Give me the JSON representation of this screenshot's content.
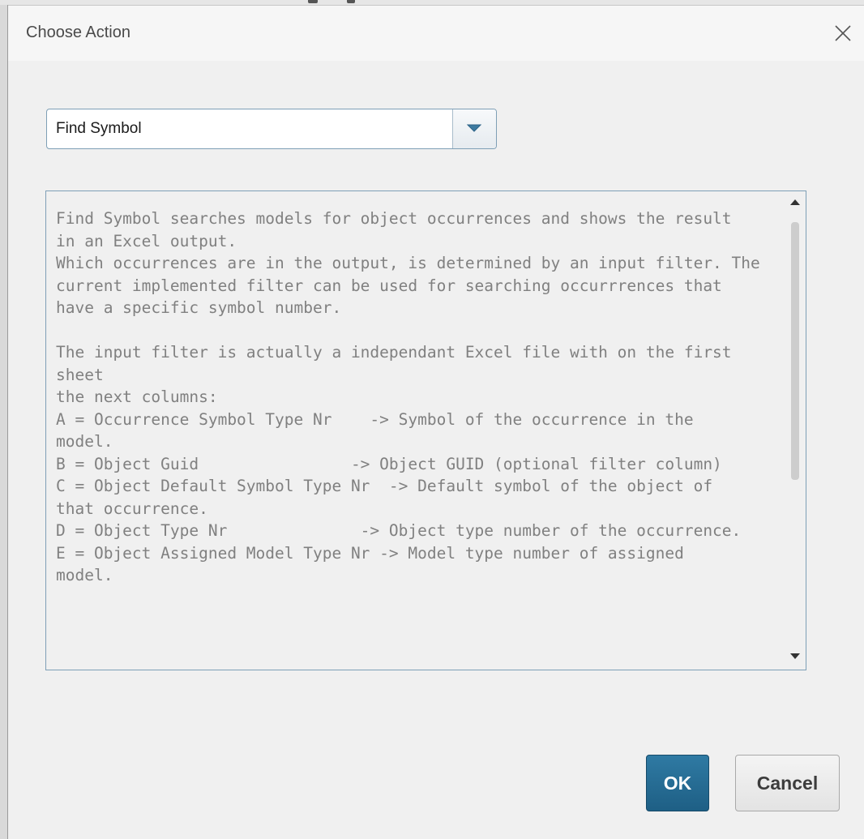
{
  "dialog": {
    "title": "Choose Action",
    "close_icon": "close-icon"
  },
  "action_select": {
    "value": "Find Symbol",
    "dropdown_icon": "triangle-down-icon"
  },
  "description": {
    "text": "Find Symbol searches models for object occurrences and shows the result\nin an Excel output.\nWhich occurrences are in the output, is determined by an input filter. The\ncurrent implemented filter can be used for searching occurrrences that\nhave a specific symbol number.\n\nThe input filter is actually a independant Excel file with on the first sheet\nthe next columns:\nA = Occurrence Symbol Type Nr    -> Symbol of the occurrence in the\nmodel.\nB = Object Guid                -> Object GUID (optional filter column)\nC = Object Default Symbol Type Nr  -> Default symbol of the object of\nthat occurrence.\nD = Object Type Nr              -> Object type number of the occurrence.\nE = Object Assigned Model Type Nr -> Model type number of assigned\nmodel."
  },
  "buttons": {
    "ok": "OK",
    "cancel": "Cancel"
  },
  "colors": {
    "primary_button": "#1e5f85",
    "border_accent": "#7e9fb6",
    "disabled_text": "#808080"
  }
}
